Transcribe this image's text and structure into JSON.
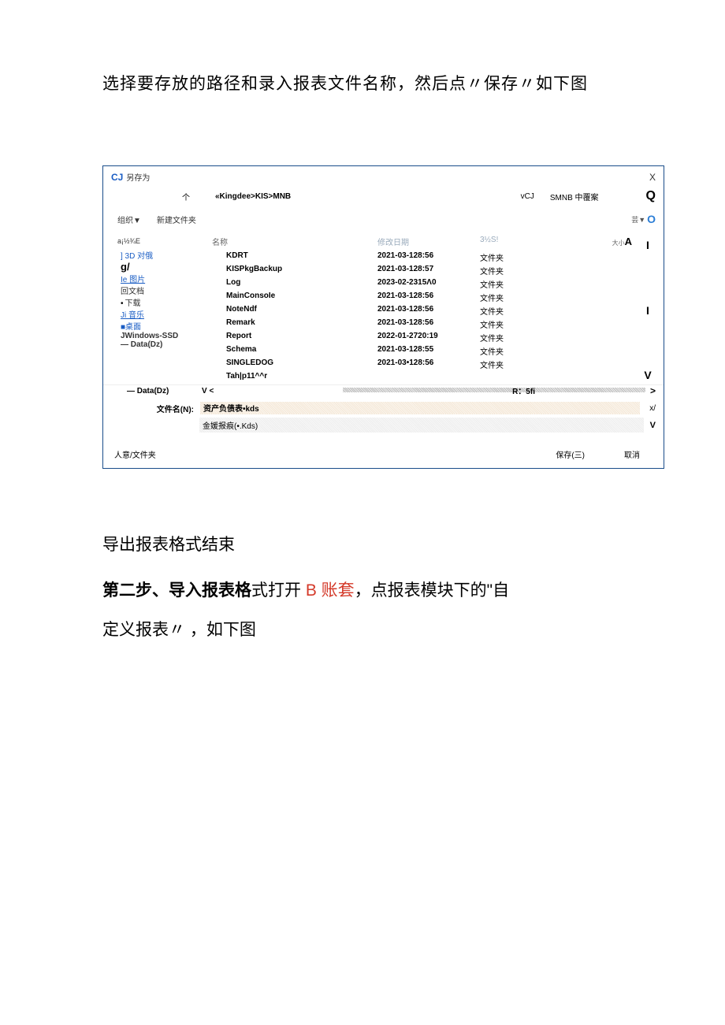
{
  "instruction_top": "选择要存放的路径和录入报表文件名称，然后点〃保存〃如下图",
  "dialog": {
    "icon": "CJ",
    "title": "另存为",
    "close": "X",
    "path_arrow": "个",
    "breadcrumb": "«Kingdee>KIS>MNB",
    "vcj": "vCJ",
    "smnb": "SMNB 中覆案",
    "toolbar": {
      "org": "组织▼",
      "newfolder": "新建文件夹",
      "view_label": "芸▼"
    },
    "sidebar_head": "a¡½¾E",
    "sidebar": [
      {
        "label": "] 3D 对俄",
        "cls": "noline"
      },
      {
        "label": "g/",
        "cls": "g"
      },
      {
        "label": "Ie 图片",
        "cls": ""
      },
      {
        "label": "回文档",
        "cls": "blackish"
      },
      {
        "label": "下载",
        "cls": "blackish bullet"
      },
      {
        "label": "Ji 音乐",
        "cls": ""
      },
      {
        "label": "■桌面",
        "cls": "noline"
      },
      {
        "label": "JWindows-SSD",
        "cls": "blackish",
        "bold": true
      },
      {
        "label": "— Data(Dz)",
        "cls": "dash",
        "bold": true
      }
    ],
    "columns": {
      "name": "名称",
      "date": "修改日期",
      "type": "3½S!",
      "size_small": "大小",
      "size_big": "A"
    },
    "rows": [
      {
        "name": "KDRT",
        "date": "2021-03-128:56",
        "type": "文件夹"
      },
      {
        "name": "KISPkgBackup",
        "date": "2021-03-128:57",
        "type": "文件夹"
      },
      {
        "name": "Log",
        "date": "2023-02-2315Λ0",
        "type": "文件夹"
      },
      {
        "name": "MainConsoIe",
        "date": "2021-03-128:56",
        "type": "文件夹"
      },
      {
        "name": "NoteNdf",
        "date": "2021-03-128:56",
        "type": "文件夹"
      },
      {
        "name": "Remark",
        "date": "2021-03-128:56",
        "type": "文件夹"
      },
      {
        "name": "Report",
        "date": "2022-01-2720:19",
        "type": "文件夹"
      },
      {
        "name": "Schema",
        "date": "2021-03-128:55",
        "type": "文件夹"
      },
      {
        "name": "SINGLEDOG",
        "date": "2021-03•128:56",
        "type": "文件夹"
      },
      {
        "name": "Tah|p11^^r",
        "date": "",
        "type": ""
      }
    ],
    "rfi": "R：5fi",
    "data_dz_scroll": "— Data(Dz)",
    "v_mark": "V  <",
    "scroll_end_down": "V",
    "scroll_end_right": ">",
    "filename": {
      "label": "文件名(N):",
      "value": "资产负债表•kds",
      "end": "x/"
    },
    "filetype": {
      "value": "金媛报痕(•.Kds)",
      "v": "V"
    },
    "footer": {
      "hide": "人意/文件夹",
      "save": "保存(三)",
      "cancel": "取消"
    }
  },
  "after": {
    "line1": "导出报表格式结束",
    "line2_bold": "第二步、导入报表格",
    "line2_plain1": "式打开 ",
    "line2_red": "B 账套",
    "line2_plain2": "，点报表模块下的\"自",
    "line3": "定义报表〃 ，如下图"
  }
}
